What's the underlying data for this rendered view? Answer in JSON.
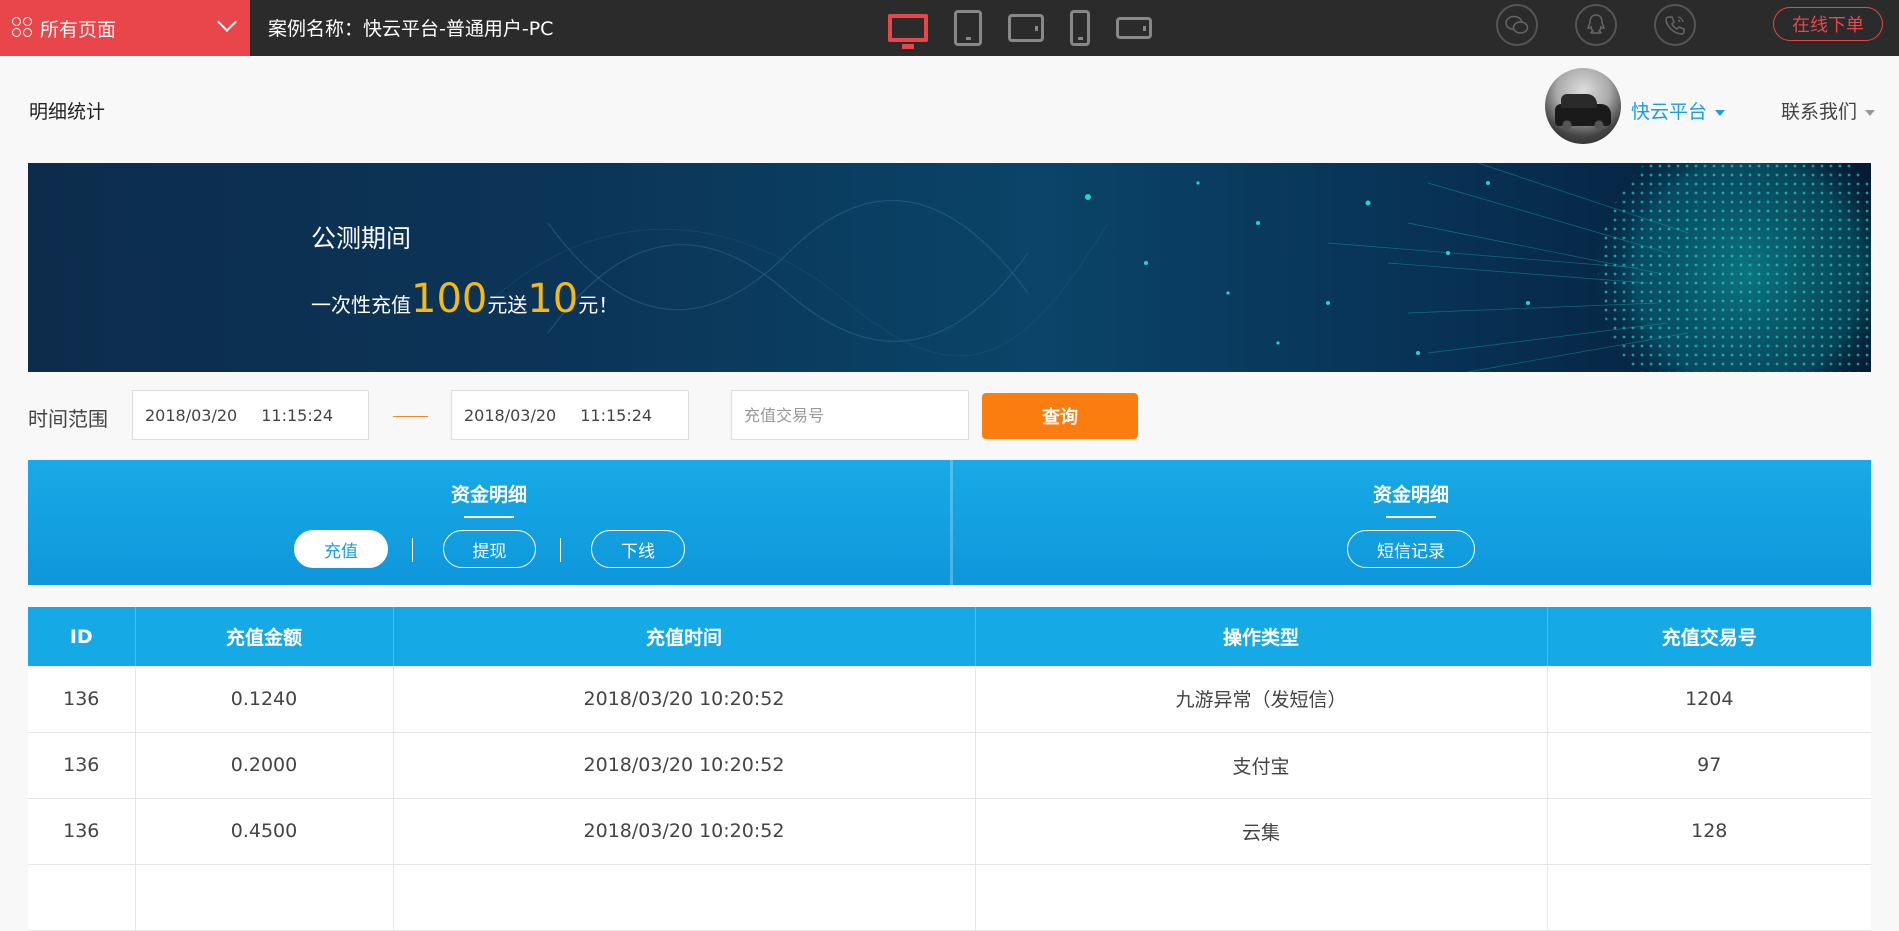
{
  "topbar": {
    "all_pages_label": "所有页面",
    "case_name": "案例名称：快云平台-普通用户-PC",
    "devices": [
      "desktop-icon",
      "tablet-icon",
      "tablet-landscape-icon",
      "phone-icon",
      "phone-landscape-icon"
    ],
    "social": [
      "wechat-icon",
      "qq-icon",
      "phone-call-icon"
    ],
    "order_label": "在线下单",
    "accent": "#e8464a"
  },
  "header": {
    "title": "明细统计",
    "user_name": "快云平台",
    "contact_label": "联系我们"
  },
  "banner": {
    "title": "公测期间",
    "promo_prefix": "一次性充值",
    "promo_amount": "100",
    "promo_mid": "元送",
    "promo_bonus": "10",
    "promo_suffix": "元！"
  },
  "filter": {
    "label": "时间范围",
    "start_date": "2018/03/20",
    "start_time": "11:15:24",
    "end_date": "2018/03/20",
    "end_time": "11:15:24",
    "txn_placeholder": "充值交易号",
    "query_label": "查询",
    "query_color": "#fb7d10"
  },
  "tabs": {
    "left_title": "资金明细",
    "left_items": [
      "充值",
      "提现",
      "下线"
    ],
    "right_title": "资金明细",
    "right_items": [
      "短信记录"
    ]
  },
  "table": {
    "columns": [
      "ID",
      "充值金额",
      "充值时间",
      "操作类型",
      "充值交易号"
    ],
    "rows": [
      [
        "136",
        "0.1240",
        "2018/03/20 10:20:52",
        "九游异常（发短信）",
        "1204"
      ],
      [
        "136",
        "0.2000",
        "2018/03/20 10:20:52",
        "支付宝",
        "97"
      ],
      [
        "136",
        "0.4500",
        "2018/03/20 10:20:52",
        "云集",
        "128"
      ],
      [
        "",
        "",
        "",
        "",
        ""
      ]
    ],
    "header_color": "#15a9e6"
  }
}
